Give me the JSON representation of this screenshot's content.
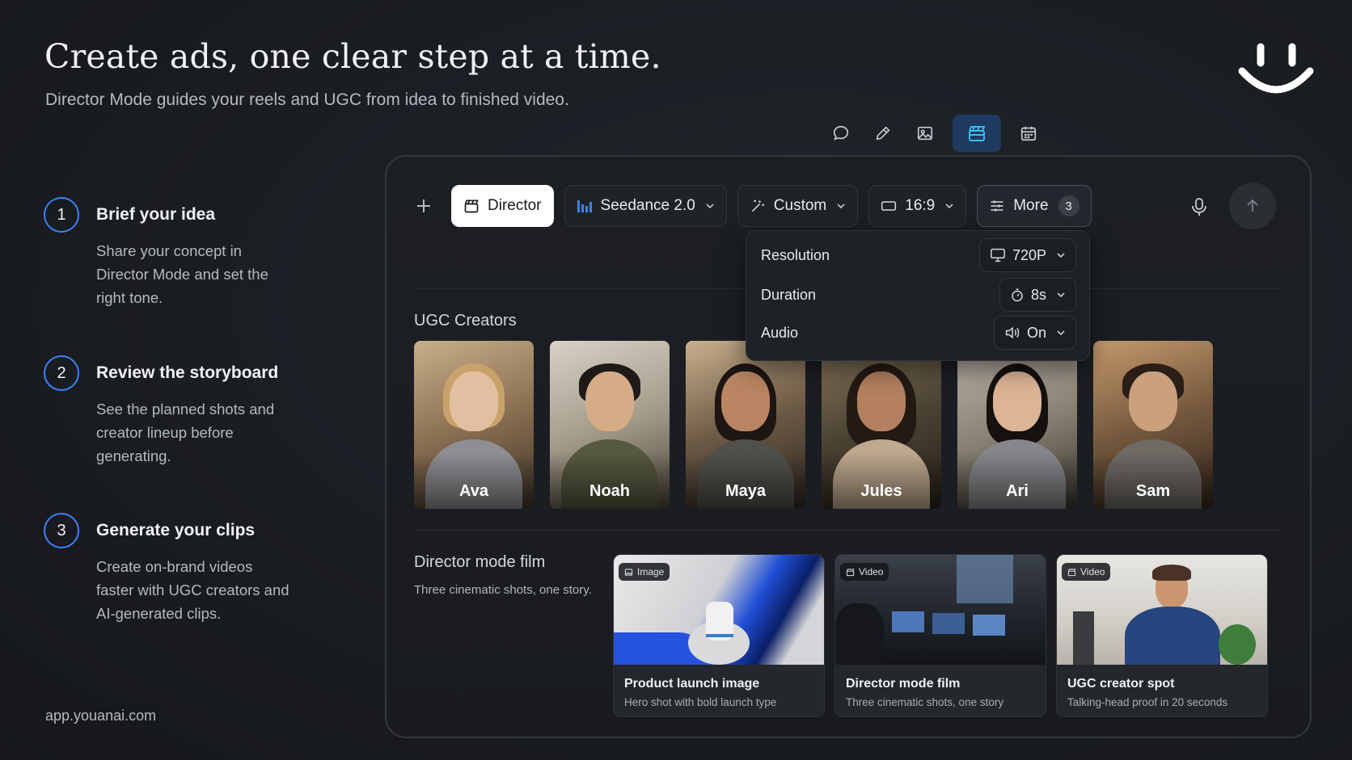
{
  "hero": {
    "headline": "Create ads, one clear step at a time.",
    "subline": "Director Mode guides your reels and UGC from idea to finished video."
  },
  "steps": [
    {
      "number": "1",
      "title": "Brief your idea",
      "description": "Share your concept in Director Mode and set the right tone."
    },
    {
      "number": "2",
      "title": "Review the storyboard",
      "description": "See the planned shots and creator lineup before generating."
    },
    {
      "number": "3",
      "title": "Generate your clips",
      "description": "Create on-brand videos faster with UGC creators and AI-generated clips."
    }
  ],
  "footer": {
    "url": "app.youanai.com"
  },
  "mode_bar": {
    "items": [
      "chat-icon",
      "edit-icon",
      "image-icon",
      "clapperboard-icon",
      "calendar-icon"
    ],
    "active": "clapperboard-icon"
  },
  "toolbar": {
    "director_label": "Director",
    "model_label": "Seedance 2.0",
    "style_label": "Custom",
    "ratio_label": "16:9",
    "more_label": "More",
    "more_count": "3"
  },
  "settings_popup": {
    "resolution_label": "Resolution",
    "resolution_value": "720P",
    "duration_label": "Duration",
    "duration_value": "8s",
    "audio_label": "Audio",
    "audio_value": "On"
  },
  "ugc": {
    "title": "UGC Creators",
    "creators": [
      "Ava",
      "Noah",
      "Maya",
      "Jules",
      "Ari",
      "Sam"
    ]
  },
  "film": {
    "title": "Director mode film",
    "subtitle": "Three cinematic shots, one story.",
    "cards": [
      {
        "tag": "Image",
        "title": "Product launch image",
        "subtitle": "Hero shot with bold launch type"
      },
      {
        "tag": "Video",
        "title": "Director mode film",
        "subtitle": "Three cinematic shots, one story"
      },
      {
        "tag": "Video",
        "title": "UGC creator spot",
        "subtitle": "Talking-head proof in 20 seconds"
      }
    ]
  },
  "colors": {
    "accent_blue": "#3b82f6",
    "active_mode_bg": "#1e3a5f",
    "active_mode_icon": "#38bdf8",
    "background": "#1a1d22"
  }
}
